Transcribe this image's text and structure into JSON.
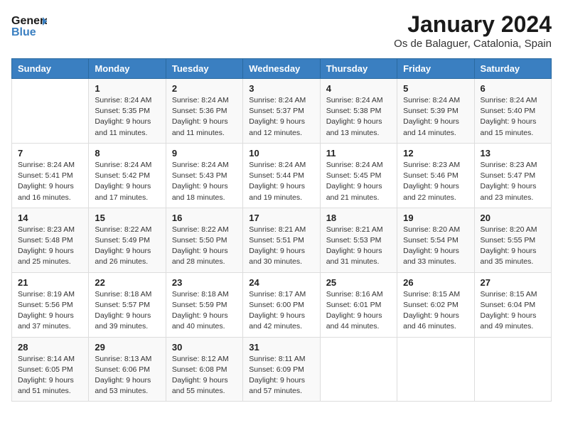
{
  "header": {
    "logo_general": "General",
    "logo_blue": "Blue",
    "title": "January 2024",
    "subtitle": "Os de Balaguer, Catalonia, Spain"
  },
  "calendar": {
    "days_of_week": [
      "Sunday",
      "Monday",
      "Tuesday",
      "Wednesday",
      "Thursday",
      "Friday",
      "Saturday"
    ],
    "weeks": [
      [
        {
          "day": "",
          "sunrise": "",
          "sunset": "",
          "daylight": ""
        },
        {
          "day": "1",
          "sunrise": "Sunrise: 8:24 AM",
          "sunset": "Sunset: 5:35 PM",
          "daylight": "Daylight: 9 hours and 11 minutes."
        },
        {
          "day": "2",
          "sunrise": "Sunrise: 8:24 AM",
          "sunset": "Sunset: 5:36 PM",
          "daylight": "Daylight: 9 hours and 11 minutes."
        },
        {
          "day": "3",
          "sunrise": "Sunrise: 8:24 AM",
          "sunset": "Sunset: 5:37 PM",
          "daylight": "Daylight: 9 hours and 12 minutes."
        },
        {
          "day": "4",
          "sunrise": "Sunrise: 8:24 AM",
          "sunset": "Sunset: 5:38 PM",
          "daylight": "Daylight: 9 hours and 13 minutes."
        },
        {
          "day": "5",
          "sunrise": "Sunrise: 8:24 AM",
          "sunset": "Sunset: 5:39 PM",
          "daylight": "Daylight: 9 hours and 14 minutes."
        },
        {
          "day": "6",
          "sunrise": "Sunrise: 8:24 AM",
          "sunset": "Sunset: 5:40 PM",
          "daylight": "Daylight: 9 hours and 15 minutes."
        }
      ],
      [
        {
          "day": "7",
          "sunrise": "Sunrise: 8:24 AM",
          "sunset": "Sunset: 5:41 PM",
          "daylight": "Daylight: 9 hours and 16 minutes."
        },
        {
          "day": "8",
          "sunrise": "Sunrise: 8:24 AM",
          "sunset": "Sunset: 5:42 PM",
          "daylight": "Daylight: 9 hours and 17 minutes."
        },
        {
          "day": "9",
          "sunrise": "Sunrise: 8:24 AM",
          "sunset": "Sunset: 5:43 PM",
          "daylight": "Daylight: 9 hours and 18 minutes."
        },
        {
          "day": "10",
          "sunrise": "Sunrise: 8:24 AM",
          "sunset": "Sunset: 5:44 PM",
          "daylight": "Daylight: 9 hours and 19 minutes."
        },
        {
          "day": "11",
          "sunrise": "Sunrise: 8:24 AM",
          "sunset": "Sunset: 5:45 PM",
          "daylight": "Daylight: 9 hours and 21 minutes."
        },
        {
          "day": "12",
          "sunrise": "Sunrise: 8:23 AM",
          "sunset": "Sunset: 5:46 PM",
          "daylight": "Daylight: 9 hours and 22 minutes."
        },
        {
          "day": "13",
          "sunrise": "Sunrise: 8:23 AM",
          "sunset": "Sunset: 5:47 PM",
          "daylight": "Daylight: 9 hours and 23 minutes."
        }
      ],
      [
        {
          "day": "14",
          "sunrise": "Sunrise: 8:23 AM",
          "sunset": "Sunset: 5:48 PM",
          "daylight": "Daylight: 9 hours and 25 minutes."
        },
        {
          "day": "15",
          "sunrise": "Sunrise: 8:22 AM",
          "sunset": "Sunset: 5:49 PM",
          "daylight": "Daylight: 9 hours and 26 minutes."
        },
        {
          "day": "16",
          "sunrise": "Sunrise: 8:22 AM",
          "sunset": "Sunset: 5:50 PM",
          "daylight": "Daylight: 9 hours and 28 minutes."
        },
        {
          "day": "17",
          "sunrise": "Sunrise: 8:21 AM",
          "sunset": "Sunset: 5:51 PM",
          "daylight": "Daylight: 9 hours and 30 minutes."
        },
        {
          "day": "18",
          "sunrise": "Sunrise: 8:21 AM",
          "sunset": "Sunset: 5:53 PM",
          "daylight": "Daylight: 9 hours and 31 minutes."
        },
        {
          "day": "19",
          "sunrise": "Sunrise: 8:20 AM",
          "sunset": "Sunset: 5:54 PM",
          "daylight": "Daylight: 9 hours and 33 minutes."
        },
        {
          "day": "20",
          "sunrise": "Sunrise: 8:20 AM",
          "sunset": "Sunset: 5:55 PM",
          "daylight": "Daylight: 9 hours and 35 minutes."
        }
      ],
      [
        {
          "day": "21",
          "sunrise": "Sunrise: 8:19 AM",
          "sunset": "Sunset: 5:56 PM",
          "daylight": "Daylight: 9 hours and 37 minutes."
        },
        {
          "day": "22",
          "sunrise": "Sunrise: 8:18 AM",
          "sunset": "Sunset: 5:57 PM",
          "daylight": "Daylight: 9 hours and 39 minutes."
        },
        {
          "day": "23",
          "sunrise": "Sunrise: 8:18 AM",
          "sunset": "Sunset: 5:59 PM",
          "daylight": "Daylight: 9 hours and 40 minutes."
        },
        {
          "day": "24",
          "sunrise": "Sunrise: 8:17 AM",
          "sunset": "Sunset: 6:00 PM",
          "daylight": "Daylight: 9 hours and 42 minutes."
        },
        {
          "day": "25",
          "sunrise": "Sunrise: 8:16 AM",
          "sunset": "Sunset: 6:01 PM",
          "daylight": "Daylight: 9 hours and 44 minutes."
        },
        {
          "day": "26",
          "sunrise": "Sunrise: 8:15 AM",
          "sunset": "Sunset: 6:02 PM",
          "daylight": "Daylight: 9 hours and 46 minutes."
        },
        {
          "day": "27",
          "sunrise": "Sunrise: 8:15 AM",
          "sunset": "Sunset: 6:04 PM",
          "daylight": "Daylight: 9 hours and 49 minutes."
        }
      ],
      [
        {
          "day": "28",
          "sunrise": "Sunrise: 8:14 AM",
          "sunset": "Sunset: 6:05 PM",
          "daylight": "Daylight: 9 hours and 51 minutes."
        },
        {
          "day": "29",
          "sunrise": "Sunrise: 8:13 AM",
          "sunset": "Sunset: 6:06 PM",
          "daylight": "Daylight: 9 hours and 53 minutes."
        },
        {
          "day": "30",
          "sunrise": "Sunrise: 8:12 AM",
          "sunset": "Sunset: 6:08 PM",
          "daylight": "Daylight: 9 hours and 55 minutes."
        },
        {
          "day": "31",
          "sunrise": "Sunrise: 8:11 AM",
          "sunset": "Sunset: 6:09 PM",
          "daylight": "Daylight: 9 hours and 57 minutes."
        },
        {
          "day": "",
          "sunrise": "",
          "sunset": "",
          "daylight": ""
        },
        {
          "day": "",
          "sunrise": "",
          "sunset": "",
          "daylight": ""
        },
        {
          "day": "",
          "sunrise": "",
          "sunset": "",
          "daylight": ""
        }
      ]
    ]
  }
}
